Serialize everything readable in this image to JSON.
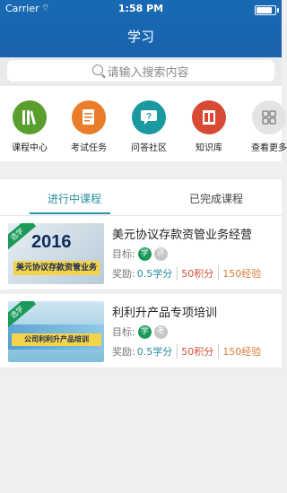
{
  "status": {
    "carrier": "Carrier",
    "wifi": "⌔",
    "time": "1:58 PM",
    "battery_level": 0.95
  },
  "header": {
    "title": "学习"
  },
  "search": {
    "placeholder": "请输入搜索内容"
  },
  "shortcuts": [
    {
      "label": "课程中心",
      "icon": "books-icon",
      "color": "#5a9e2e",
      "glyph": "▥"
    },
    {
      "label": "考试任务",
      "icon": "exam-icon",
      "color": "#ea7d2a",
      "glyph": "✎"
    },
    {
      "label": "问答社区",
      "icon": "qa-icon",
      "color": "#1a9aa0",
      "glyph": "?"
    },
    {
      "label": "知识库",
      "icon": "library-icon",
      "color": "#d84a34",
      "glyph": "▦"
    },
    {
      "label": "查看更多",
      "icon": "grid-icon",
      "color": "#d9d9d9",
      "glyph": "▦"
    }
  ],
  "tabs": {
    "active": "进行中课程",
    "inactive": "已完成课程"
  },
  "courses": [
    {
      "title": "美元协议存款资管业务经营",
      "thumb_text_big": "2016",
      "thumb_text_small": "美元协议存款资管业务",
      "ribbon": "选学",
      "goal_label": "目标:",
      "goal_badges": [
        {
          "text": "学",
          "color": "#1a9a5a"
        },
        {
          "text": "评",
          "color": "#c6c6c6"
        }
      ],
      "reward_label": "奖励:",
      "credit": "0.5学分",
      "score": "50积分",
      "exp": "150经验"
    },
    {
      "title": "利利升产品专项培训",
      "thumb_text_big": "",
      "thumb_text_small": "公司利利升产品培训",
      "ribbon": "选学",
      "goal_label": "目标:",
      "goal_badges": [
        {
          "text": "学",
          "color": "#1a9a5a"
        },
        {
          "text": "考",
          "color": "#c6c6c6"
        }
      ],
      "reward_label": "奖励:",
      "credit": "0.5学分",
      "score": "50积分",
      "exp": "150经验"
    }
  ]
}
